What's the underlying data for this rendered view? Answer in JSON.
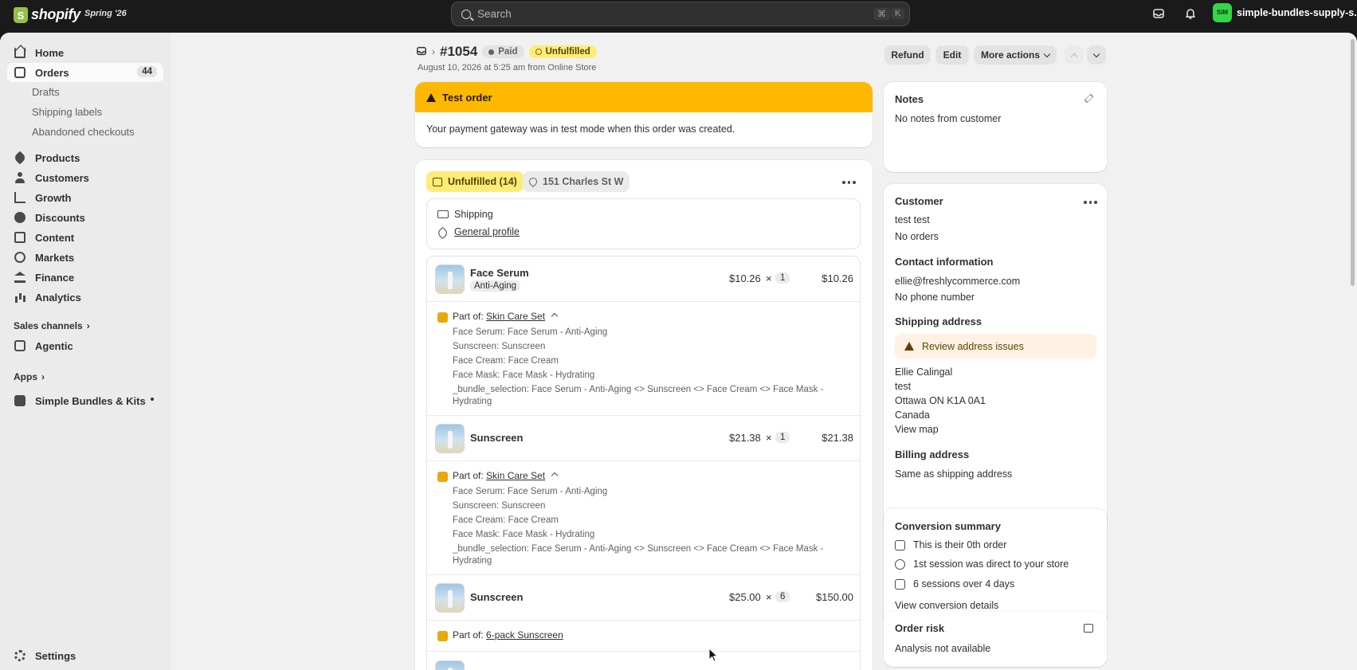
{
  "topbar": {
    "logo": "shopify",
    "edition": "Spring '26",
    "search_placeholder": "Search",
    "shortcut_cmd": "⌘",
    "shortcut_key": "K",
    "store_initials": "SIM",
    "store_name": "simple-bundles-supply-s..."
  },
  "sidebar": {
    "home": "Home",
    "orders": "Orders",
    "orders_count": "44",
    "drafts": "Drafts",
    "shipping_labels": "Shipping labels",
    "abandoned": "Abandoned checkouts",
    "products": "Products",
    "customers": "Customers",
    "growth": "Growth",
    "discounts": "Discounts",
    "content": "Content",
    "markets": "Markets",
    "finance": "Finance",
    "analytics": "Analytics",
    "sales_channels": "Sales channels",
    "agentic": "Agentic",
    "apps": "Apps",
    "simple_bundles": "Simple Bundles & Kits",
    "settings": "Settings"
  },
  "order": {
    "number": "#1054",
    "payment_status": "Paid",
    "fulfillment_status": "Unfulfilled",
    "subtitle": "August 10, 2026 at 5:25 am from Online Store",
    "refund": "Refund",
    "edit": "Edit",
    "more_actions": "More actions"
  },
  "test_banner": {
    "title": "Test order",
    "body": "Your payment gateway was in test mode when this order was created."
  },
  "fulfillment": {
    "status_pill": "Unfulfilled (14)",
    "location_pill": "151 Charles St W",
    "shipping_label": "Shipping",
    "profile_link": "General profile",
    "part_of_label": "Part of:",
    "items": [
      {
        "name": "Face Serum",
        "variant": "Anti-Aging",
        "unit_price": "$10.26",
        "times": "×",
        "qty": "1",
        "total": "$10.26",
        "bundle": "Skin Care Set",
        "bundle_lines": [
          "Face Serum: Face Serum - Anti-Aging",
          "Sunscreen: Sunscreen",
          "Face Cream: Face Cream",
          "Face Mask: Face Mask - Hydrating",
          "_bundle_selection: Face Serum - Anti-Aging <> Sunscreen <> Face Cream <> Face Mask - Hydrating"
        ]
      },
      {
        "name": "Sunscreen",
        "unit_price": "$21.38",
        "times": "×",
        "qty": "1",
        "total": "$21.38",
        "bundle": "Skin Care Set",
        "bundle_lines": [
          "Face Serum: Face Serum - Anti-Aging",
          "Sunscreen: Sunscreen",
          "Face Cream: Face Cream",
          "Face Mask: Face Mask - Hydrating",
          "_bundle_selection: Face Serum - Anti-Aging <> Sunscreen <> Face Cream <> Face Mask - Hydrating"
        ]
      },
      {
        "name": "Sunscreen",
        "unit_price": "$25.00",
        "times": "×",
        "qty": "6",
        "total": "$150.00",
        "bundle": "6-pack Sunscreen"
      }
    ]
  },
  "notes": {
    "title": "Notes",
    "body": "No notes from customer"
  },
  "customer": {
    "title": "Customer",
    "name": "test test",
    "orders": "No orders",
    "contact_title": "Contact information",
    "email": "ellie@freshlycommerce.com",
    "phone": "No phone number",
    "shipping_title": "Shipping address",
    "review": "Review address issues",
    "address": [
      "Ellie Calingal",
      "test",
      "Ottawa ON K1A 0A1",
      "Canada"
    ],
    "view_map": "View map",
    "billing_title": "Billing address",
    "billing": "Same as shipping address"
  },
  "conversion": {
    "title": "Conversion summary",
    "rows": [
      "This is their 0th order",
      "1st session was direct to your store",
      "6 sessions over 4 days"
    ],
    "link": "View conversion details"
  },
  "risk": {
    "title": "Order risk",
    "body": "Analysis not available"
  },
  "colors": {
    "accent_link": "#005bd3",
    "banner": "#ffb800",
    "unfulfilled": "#ffeb78",
    "store_avatar": "#36d649"
  }
}
